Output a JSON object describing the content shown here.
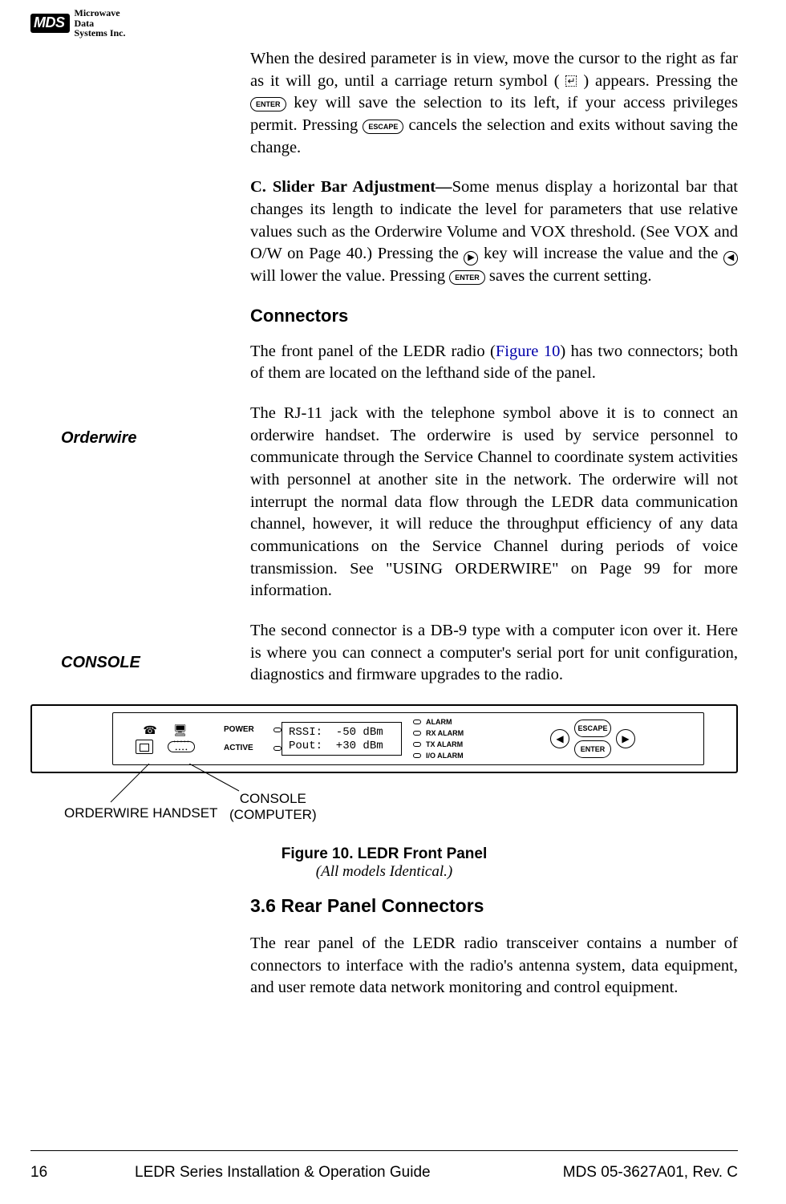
{
  "logo": {
    "badge": "MDS",
    "line1": "Microwave",
    "line2": "Data",
    "line3": "Systems Inc."
  },
  "para1": {
    "t1": "When the desired parameter is in view, move the cursor to the right as far as it will go, until a carriage return symbol (",
    "t2": ") appears. Pressing the ",
    "key_enter": "ENTER",
    "t3": " key will save the selection to its left, if your access privileges permit. Pressing ",
    "key_escape": "ESCAPE",
    "t4": " cancels the selection and exits without saving the change."
  },
  "para2": {
    "bold": "C. Slider Bar Adjustment—",
    "t1": "Some menus display a horizontal bar that changes its length to indicate the level for parameters that use relative values such as the Orderwire Volume and VOX threshold. (See VOX and O/W on Page 40.) Pressing the ",
    "rarrow": "▶",
    "t2": " key will increase the value and the ",
    "larrow": "◀",
    "t3": " will lower the value. Pressing ",
    "key_enter": "ENTER",
    "t4": " saves the current setting."
  },
  "h_connectors": "Connectors",
  "para3": {
    "t1": "The front panel of the LEDR radio (",
    "link": "Figure 10",
    "t2": ") has two connectors; both of them are located on the lefthand side of the panel."
  },
  "side_orderwire": "Orderwire",
  "para4": "The RJ-11 jack with the telephone symbol above it is to connect an orderwire handset. The orderwire is used by service personnel to communicate through the Service Channel to coordinate system activities with personnel at another site in the network. The orderwire will not interrupt the normal data flow through the LEDR data communication channel, however, it will reduce the throughput efficiency of any data communications on the Service Channel during periods of voice transmission. See \"USING ORDERWIRE\" on Page 99 for more information.",
  "side_console": "CONSOLE",
  "para5": "The second connector is a DB-9 type with a computer icon over it. Here is where you can connect a computer's serial port for unit configuration, diagnostics and firmware upgrades to the radio.",
  "panel": {
    "power": "POWER",
    "active": "ACTIVE",
    "lcd": "RSSI:  -50 dBm\nPout:  +30 dBm",
    "alarms": [
      "ALARM",
      "RX ALARM",
      "TX ALARM",
      "I/O ALARM"
    ],
    "key_escape": "ESCAPE",
    "key_enter": "ENTER",
    "larrow": "◀",
    "rarrow": "▶"
  },
  "callouts": {
    "orderwire": "ORDERWIRE HANDSET",
    "console_l1": "CONSOLE",
    "console_l2": "(COMPUTER)"
  },
  "figcap": {
    "title": "Figure 10. LEDR Front Panel",
    "sub": "(All models Identical.)"
  },
  "h_36": "3.6   Rear Panel Connectors",
  "para6": "The rear panel of the LEDR radio transceiver contains a number of connectors to interface with the radio's antenna system, data equipment, and user remote data network monitoring and control equipment.",
  "footer": {
    "page": "16",
    "title": "LEDR Series Installation & Operation Guide",
    "rev": "MDS 05-3627A01, Rev. C"
  }
}
